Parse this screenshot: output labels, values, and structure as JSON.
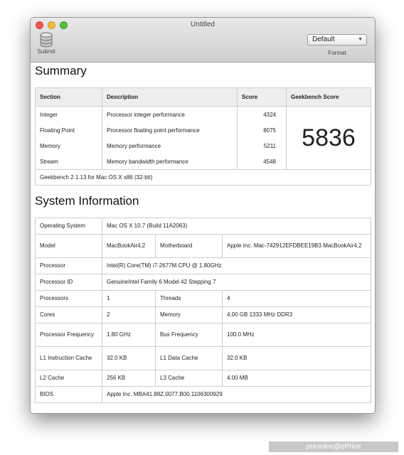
{
  "window": {
    "title": "Untitled"
  },
  "toolbar": {
    "submit_label": "Submit",
    "submit_icon": "database-icon",
    "format_value": "Default",
    "format_label": "Format"
  },
  "summary": {
    "title": "Summary",
    "headers": [
      "Section",
      "Description",
      "Score",
      "Geekbench Score"
    ],
    "rows": [
      {
        "section": "Integer",
        "description": "Processor integer performance",
        "score": "4324"
      },
      {
        "section": "Floating Point",
        "description": "Processor floating point performance",
        "score": "8075"
      },
      {
        "section": "Memory",
        "description": "Memory performance",
        "score": "5211"
      },
      {
        "section": "Stream",
        "description": "Memory bandwidth performance",
        "score": "4548"
      }
    ],
    "geekbench_score": "5836",
    "footer": "Geekbench 2.1.13 for Mac OS X x86 (32-bit)"
  },
  "system": {
    "title": "System Information",
    "operating_system": {
      "label": "Operating System",
      "value": "Mac OS X 10.7 (Build 11A2063)"
    },
    "model": {
      "label": "Model",
      "value": "MacBookAir4,2"
    },
    "motherboard": {
      "label": "Motherboard",
      "value": "Apple Inc. Mac-742912EFDBEE19B3 MacBookAir4,2"
    },
    "processor": {
      "label": "Processor",
      "value": "Intel(R) Core(TM) i7-2677M CPU @ 1.80GHz"
    },
    "processor_id": {
      "label": "Processor ID",
      "value": "GenuineIntel Family 6 Model 42 Stepping 7"
    },
    "processors": {
      "label": "Processors",
      "value": "1"
    },
    "threads": {
      "label": "Threads",
      "value": "4"
    },
    "cores": {
      "label": "Cores",
      "value": "2"
    },
    "memory": {
      "label": "Memory",
      "value": "4.00 GB  1333 MHz DDR3"
    },
    "processor_frequency": {
      "label": "Processor Frequency",
      "value": "1.80 GHz"
    },
    "bus_frequency": {
      "label": "Bus Frequency",
      "value": "100.0 MHz"
    },
    "l1_instruction_cache": {
      "label": "L1 Instruction Cache",
      "value": "32.0 KB"
    },
    "l1_data_cache": {
      "label": "L1 Data Cache",
      "value": "32.0 KB"
    },
    "l2_cache": {
      "label": "L2 Cache",
      "value": "256 KB"
    },
    "l3_cache": {
      "label": "L3 Cache",
      "value": "4.00 MB"
    },
    "bios": {
      "label": "BIOS",
      "value": "Apple Inc. MBA41.88Z.0077.B00.1106300929"
    }
  },
  "credit": "primolee@ePrice"
}
